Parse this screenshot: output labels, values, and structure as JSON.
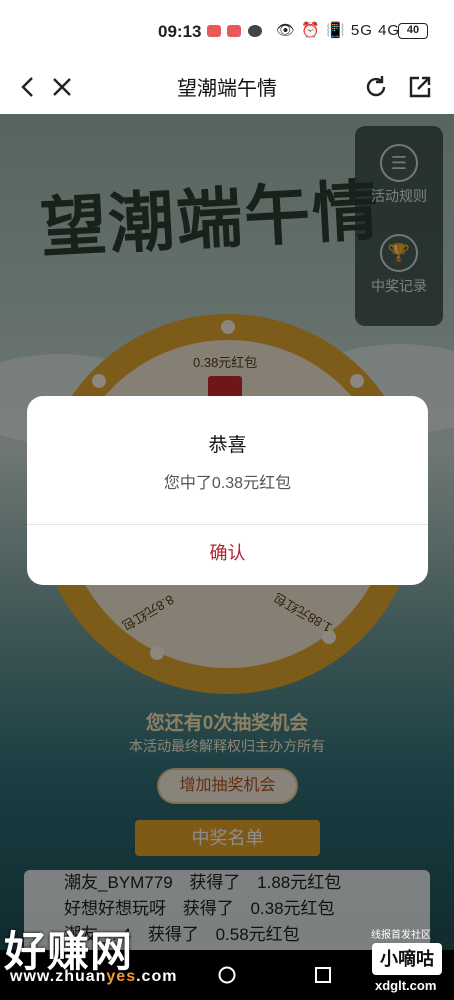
{
  "status": {
    "time": "09:13",
    "right_icons": "👁 ⏰ 📳 5G 4G",
    "battery": "40"
  },
  "nav": {
    "title": "望潮端午情"
  },
  "page": {
    "banner_title": "望潮端午情",
    "side_panel": [
      {
        "label": "活动规则",
        "icon": "rules-icon"
      },
      {
        "label": "中奖记录",
        "icon": "trophy-icon"
      }
    ],
    "wheel": {
      "visible_prizes": [
        "0.38元红包",
        "8.8元红包",
        "1.88元红包"
      ]
    },
    "remaining_text": "您还有0次抽奖机会",
    "rules_note": "本活动最终解释权归主办方所有",
    "add_chance_button": "增加抽奖机会",
    "winners_header": "中奖名单",
    "winners": [
      {
        "user": "潮友_BYM779",
        "action": "获得了",
        "prize": "1.88元红包"
      },
      {
        "user": "好想好想玩呀",
        "action": "获得了",
        "prize": "0.38元红包"
      },
      {
        "user": "潮友_...4",
        "action": "获得了",
        "prize": "0.58元红包"
      }
    ]
  },
  "dialog": {
    "title": "恭喜",
    "message": "您中了0.38元红包",
    "confirm": "确认"
  },
  "watermarks": {
    "left_main": "好赚网",
    "left_sub_a": "www.zhuan",
    "left_sub_b": "yes",
    "left_sub_c": ".com",
    "right_top": "线报首发社区",
    "right_badge": "小嘀咕",
    "right_bottom": "xdglt.com"
  }
}
